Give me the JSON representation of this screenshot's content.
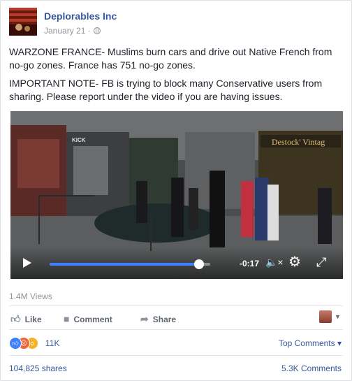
{
  "post": {
    "page_name": "Deplorables Inc",
    "date": "January 21 ·",
    "text_lines": [
      "WARZONE FRANCE- Muslims burn cars and drive out Native French from no-go zones. France has 751 no-go zones.",
      "IMPORTANT NOTE- FB is trying to block many Conservative users from sharing. Please report under the video if you are having issues."
    ]
  },
  "video": {
    "time_remaining": "-0:17",
    "progress": 0.93,
    "storefront_sign": "Destock' Vintag",
    "shop_sign": "KICK"
  },
  "stats": {
    "views": "1.4M Views",
    "reactions_count": "11K",
    "shares": "104,825 shares",
    "comments": "5.3K Comments"
  },
  "actions": {
    "like": "Like",
    "comment": "Comment",
    "share": "Share"
  },
  "top_comments": "Top Comments ▾",
  "colors": {
    "link": "#365899",
    "like_blue": "#4080ff",
    "angry": "#f0653b",
    "wow": "#f7b125"
  }
}
